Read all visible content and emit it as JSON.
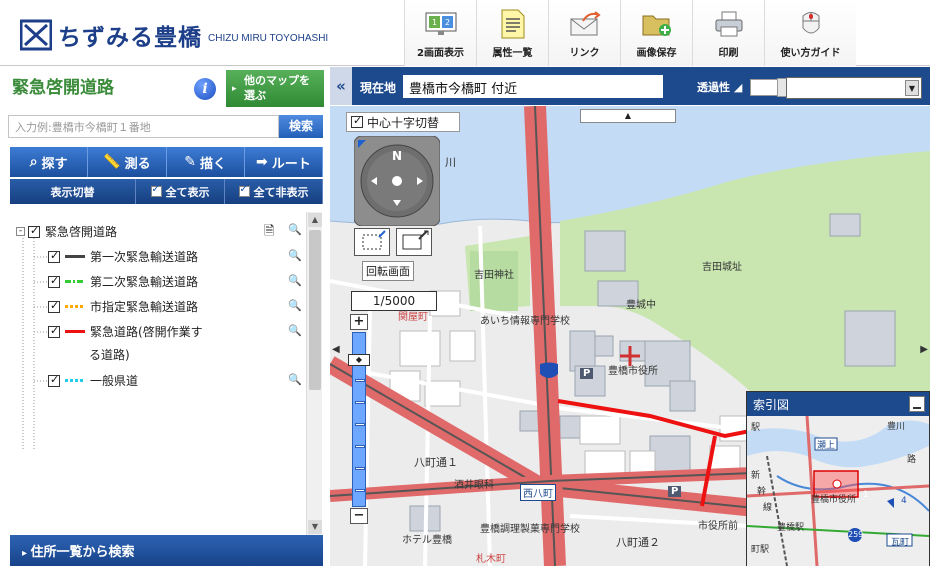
{
  "app": {
    "title_jp": "ちずみる豊橋",
    "title_en": "CHIZU MIRU TOYOHASHI"
  },
  "toolbar": {
    "items": [
      {
        "label": "2画面表示",
        "icon": "dual-screen-icon"
      },
      {
        "label": "属性一覧",
        "icon": "attribute-list-icon"
      },
      {
        "label": "リンク",
        "icon": "link-mail-icon"
      },
      {
        "label": "画像保存",
        "icon": "image-save-folder-icon"
      },
      {
        "label": "印刷",
        "icon": "printer-icon"
      },
      {
        "label": "使い方ガイド",
        "icon": "mouse-guide-icon"
      }
    ]
  },
  "left_panel": {
    "title": "緊急啓開道路",
    "info_label": "i",
    "other_map_label": "他のマップを選ぶ",
    "search_placeholder": "入力例:豊橋市今橋町１番地",
    "search_button": "検索",
    "tabs": [
      {
        "label": "探す",
        "icon": "magnifier-icon"
      },
      {
        "label": "測る",
        "icon": "ruler-icon"
      },
      {
        "label": "描く",
        "icon": "brush-icon"
      },
      {
        "label": "ルート",
        "icon": "route-icon"
      }
    ],
    "display_toggle": "表示切替",
    "show_all": "全て表示",
    "hide_all": "全て非表示",
    "layer_group": "緊急啓開道路",
    "layers": [
      {
        "label": "第一次緊急輸送道路",
        "color": "#444444",
        "style": "solid"
      },
      {
        "label": "第二次緊急輸送道路",
        "color": "#33cc33",
        "style": "dash-dot"
      },
      {
        "label": "市指定緊急輸送道路",
        "color": "#ffaa00",
        "style": "dotted"
      },
      {
        "label": "緊急道路(啓開作業す",
        "label2": "る道路)",
        "color": "#ee1111",
        "style": "solid"
      },
      {
        "label": "一般県道",
        "color": "#22ccee",
        "style": "dotted"
      }
    ],
    "address_search": "住所一覧から検索"
  },
  "map_bar": {
    "location_label": "現在地",
    "location_value": "豊橋市今橋町 付近",
    "opacity_label": "透過性"
  },
  "map": {
    "crosshair_toggle": "中心十字切替",
    "rotate_label": "回転画面",
    "scale": "1/5000",
    "zoom_in": "+",
    "zoom_out": "−",
    "labels": {
      "river": "川",
      "yoshida_shrine": "吉田神社",
      "yoshida_castle": "吉田城址",
      "school": "豊城中",
      "aichi_school": "あいち情報専門学校",
      "city_hall": "豊橋市役所",
      "sekiyacho": "関屋町",
      "hacchodori1": "八町通１",
      "hacchodori2": "八町通２",
      "sakaibyoin": "酒井眼科",
      "nishihacchou": "西八町",
      "shiyakushomae": "市役所前",
      "hotel": "ホテル豊橋",
      "chorihsi": "豊橋調理製菓専門学校",
      "kotanaka": "札木町",
      "p": "P"
    },
    "colors": {
      "primary_road": "#ee6666",
      "route_red": "#ee1111",
      "water": "#c3dbf5",
      "park": "#c9e6b1"
    }
  },
  "overview": {
    "title": "索引図",
    "labels": [
      "豊川",
      "瀬上",
      "新",
      "幹",
      "線",
      "豊橋駅",
      "豊橋市役所",
      "駅",
      "町駅",
      "路",
      "瓦町",
      "4",
      "1",
      "259"
    ]
  }
}
